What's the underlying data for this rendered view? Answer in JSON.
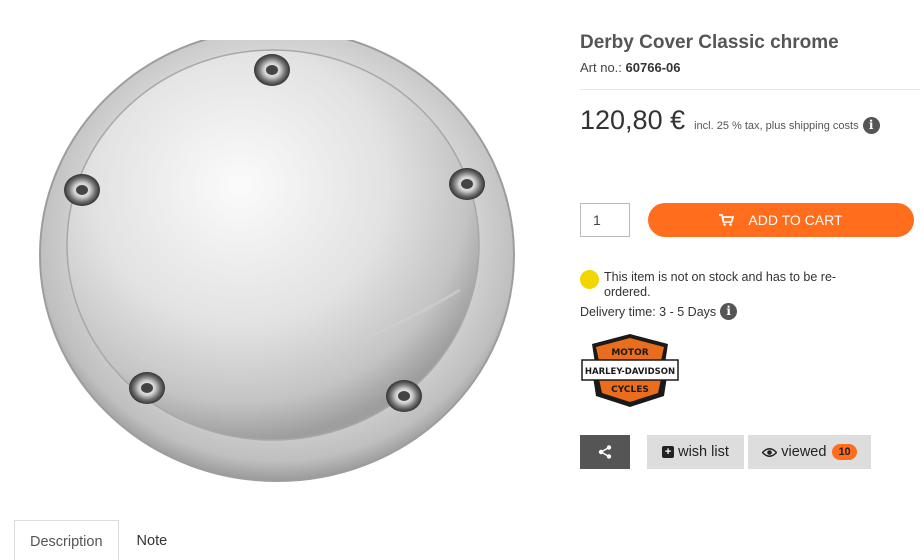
{
  "product": {
    "title": "Derby Cover Classic chrome",
    "art_no_label": "Art no.:",
    "art_no": "60766-06",
    "price": "120,80 €",
    "tax_note": "incl. 25 % tax, plus shipping costs"
  },
  "purchase": {
    "quantity": "1",
    "add_to_cart_label": "ADD TO CART"
  },
  "stock": {
    "status_text": "This item is not on stock and has to be re-ordered.",
    "delivery_text": "Delivery time: 3 - 5 Days",
    "status_color": "#f2d600"
  },
  "brand": {
    "logo_top": "MOTOR",
    "logo_middle": "HARLEY-DAVIDSON",
    "logo_bottom": "CYCLES"
  },
  "actions": {
    "wish_list_label": "wish list",
    "viewed_label": "viewed",
    "viewed_count": "10"
  },
  "tabs": [
    {
      "label": "Description"
    },
    {
      "label": "Note"
    }
  ],
  "colors": {
    "accent": "#ff6d1d",
    "dark_button": "#555555"
  },
  "icons": [
    "cart-icon",
    "info-icon",
    "share-icon",
    "plus-square-icon",
    "eye-icon"
  ]
}
